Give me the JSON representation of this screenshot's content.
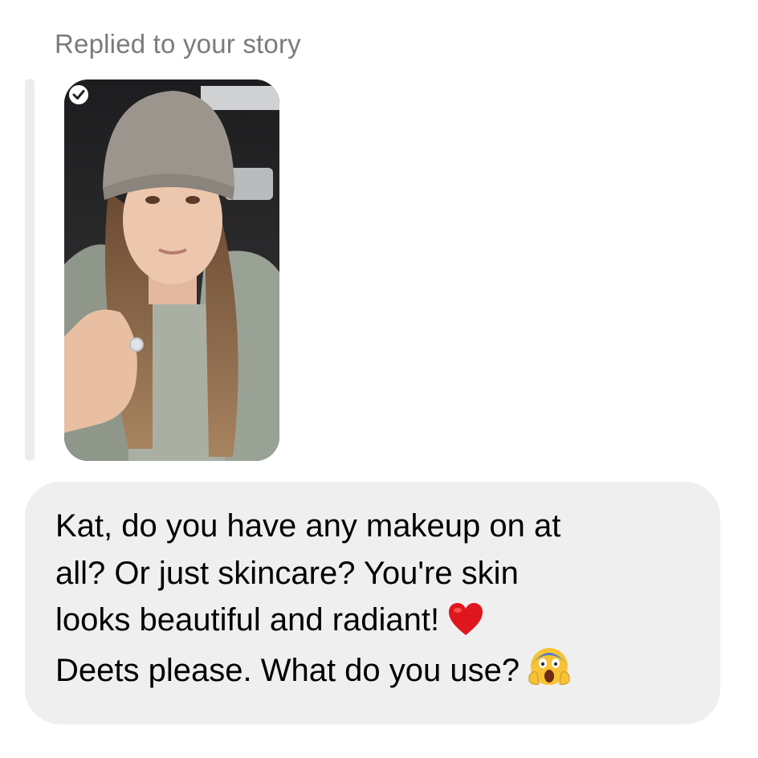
{
  "reply_context": {
    "label": "Replied to your story"
  },
  "story": {
    "thumbnail_icon": "story-thumbnail-image",
    "badge_icon": "check-badge-icon"
  },
  "message": {
    "line1": "Kat, do you have any makeup on at",
    "line2": "all? Or just skincare? You're skin",
    "line3": "looks beautiful and radiant!",
    "line4": "Deets please. What do you use?",
    "emoji_1": "red-heart-icon",
    "emoji_2": "face-screaming-in-fear-icon"
  },
  "colors": {
    "label": "#7b7b7f",
    "bubble": "#efeff0",
    "reply_bar": "#ececed"
  }
}
